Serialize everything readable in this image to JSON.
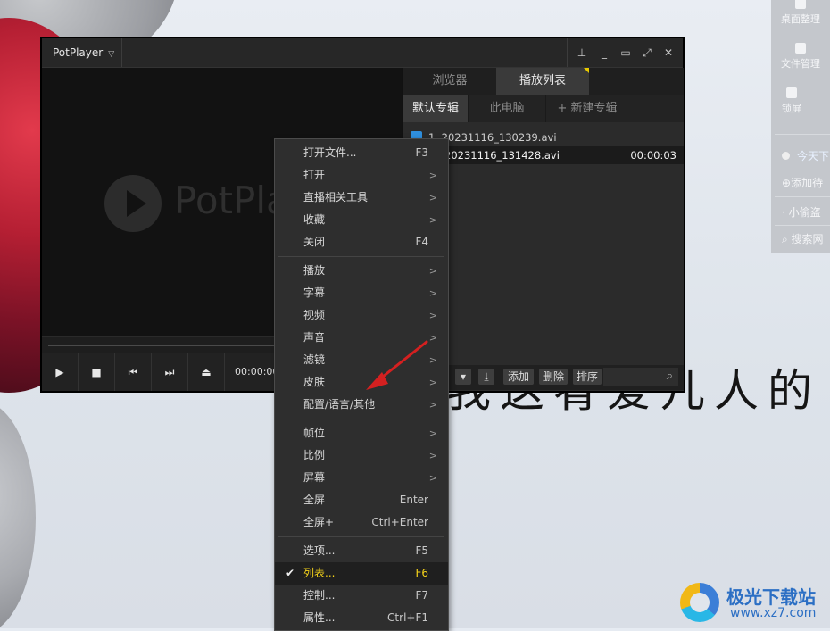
{
  "desktop": {
    "calligraphy": "我这肴爱儿人的",
    "side_panel": {
      "items": [
        {
          "label": "桌面整理",
          "icon": "grid-icon"
        },
        {
          "label": "文件管理",
          "icon": "folder-icon"
        },
        {
          "label": "锁屏",
          "icon": "lock-icon"
        }
      ],
      "today": "今天下",
      "add": "添加待",
      "tip": "小偷盗",
      "search": "搜索网"
    }
  },
  "player": {
    "app_menu": "PotPlayer",
    "logo_text": "PotPlayer",
    "time": "00:00:00",
    "panel": {
      "tabs": [
        "浏览器",
        "播放列表"
      ],
      "subtabs": [
        "默认专辑",
        "此电脑",
        "+ 新建专辑"
      ],
      "items": [
        {
          "name": "1. 20231116_130239.avi",
          "duration": ""
        },
        {
          "name": "20231116_131428.avi",
          "duration": "00:00:03"
        }
      ],
      "buttons": {
        "add": "添加",
        "delete": "删除",
        "sort": "排序"
      }
    }
  },
  "context_menu": {
    "groups": [
      [
        {
          "label": "打开文件...",
          "shortcut": "F3",
          "submenu": false
        },
        {
          "label": "打开",
          "shortcut": "",
          "submenu": true
        },
        {
          "label": "直播相关工具",
          "shortcut": "",
          "submenu": true
        },
        {
          "label": "收藏",
          "shortcut": "",
          "submenu": true
        },
        {
          "label": "关闭",
          "shortcut": "F4",
          "submenu": false
        }
      ],
      [
        {
          "label": "播放",
          "shortcut": "",
          "submenu": true
        },
        {
          "label": "字幕",
          "shortcut": "",
          "submenu": true
        },
        {
          "label": "视频",
          "shortcut": "",
          "submenu": true
        },
        {
          "label": "声音",
          "shortcut": "",
          "submenu": true
        },
        {
          "label": "滤镜",
          "shortcut": "",
          "submenu": true
        },
        {
          "label": "皮肤",
          "shortcut": "",
          "submenu": true
        },
        {
          "label": "配置/语言/其他",
          "shortcut": "",
          "submenu": true
        }
      ],
      [
        {
          "label": "帧位",
          "shortcut": "",
          "submenu": true
        },
        {
          "label": "比例",
          "shortcut": "",
          "submenu": true
        },
        {
          "label": "屏幕",
          "shortcut": "",
          "submenu": true
        },
        {
          "label": "全屏",
          "shortcut": "Enter",
          "submenu": false
        },
        {
          "label": "全屏+",
          "shortcut": "Ctrl+Enter",
          "submenu": false
        }
      ],
      [
        {
          "label": "选项...",
          "shortcut": "F5",
          "submenu": false
        },
        {
          "label": "列表...",
          "shortcut": "F6",
          "submenu": false,
          "checked": true,
          "highlighted": true
        },
        {
          "label": "控制...",
          "shortcut": "F7",
          "submenu": false
        },
        {
          "label": "属性...",
          "shortcut": "Ctrl+F1",
          "submenu": false
        }
      ]
    ],
    "highlight_color": "#f5d31a"
  },
  "watermark": {
    "title": "极光下载站",
    "url": "www.xz7.com"
  },
  "colors": {
    "arrow": "#d42020",
    "file_icon": "#2f8fde"
  }
}
